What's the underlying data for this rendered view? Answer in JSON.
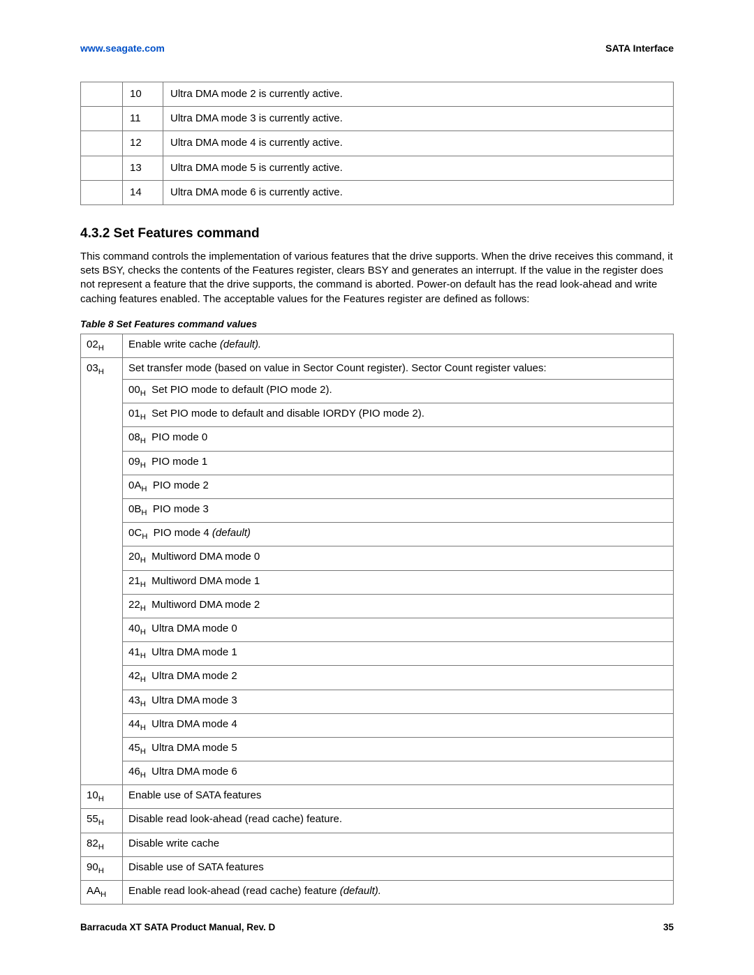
{
  "header": {
    "url": "www.seagate.com",
    "section": "SATA Interface"
  },
  "top_table": {
    "rows": [
      {
        "bit": "10",
        "desc": "Ultra DMA mode 2 is currently active."
      },
      {
        "bit": "11",
        "desc": "Ultra DMA mode 3 is currently active."
      },
      {
        "bit": "12",
        "desc": "Ultra DMA mode 4 is currently active."
      },
      {
        "bit": "13",
        "desc": "Ultra DMA mode 5 is currently active."
      },
      {
        "bit": "14",
        "desc": "Ultra DMA mode 6 is currently active."
      }
    ]
  },
  "section_head": "4.3.2  Set Features command",
  "section_text": "This command controls the implementation of various features that the drive supports. When the drive receives this command, it sets BSY, checks the contents of the Features register, clears BSY and generates an interrupt. If the value in the register does not represent a feature that the drive supports, the command is aborted. Power-on default has the read look-ahead and write caching features enabled. The acceptable values for the Features register are defined as follows:",
  "table_caption": "Table 8   Set Features command values",
  "features": {
    "row_02": {
      "code": "02",
      "desc_pre": "Enable write cache ",
      "desc_it": "(default)."
    },
    "row_03": {
      "code": "03",
      "desc": "Set transfer mode (based on value in Sector Count register). Sector Count register values:"
    },
    "sub_00": {
      "code": "00",
      "desc": "Set PIO mode to default (PIO mode 2)."
    },
    "sub_01": {
      "code": "01",
      "desc": "Set PIO mode to default and disable IORDY (PIO mode 2)."
    },
    "sub_08": {
      "code": "08",
      "desc": "PIO mode 0"
    },
    "sub_09": {
      "code": "09",
      "desc": "PIO mode 1"
    },
    "sub_0A": {
      "code": "0A",
      "desc": "PIO mode 2"
    },
    "sub_0B": {
      "code": "0B",
      "desc": "PIO mode 3"
    },
    "sub_0C": {
      "code": "0C",
      "desc_pre": "PIO mode 4 ",
      "desc_it": "(default)"
    },
    "sub_20": {
      "code": "20",
      "desc": "Multiword DMA mode 0"
    },
    "sub_21": {
      "code": "21",
      "desc": "Multiword DMA mode 1"
    },
    "sub_22": {
      "code": "22",
      "desc": "Multiword DMA mode 2"
    },
    "sub_40": {
      "code": "40",
      "desc": "Ultra DMA mode 0"
    },
    "sub_41": {
      "code": "41",
      "desc": "Ultra DMA mode 1"
    },
    "sub_42": {
      "code": "42",
      "desc": "Ultra DMA mode 2"
    },
    "sub_43": {
      "code": "43",
      "desc": "Ultra DMA mode 3"
    },
    "sub_44": {
      "code": "44",
      "desc": "Ultra DMA mode 4"
    },
    "sub_45": {
      "code": "45",
      "desc": "Ultra DMA mode 5"
    },
    "sub_46": {
      "code": "46",
      "desc": "Ultra DMA mode 6"
    },
    "row_10": {
      "code": "10",
      "desc": "Enable use of SATA features"
    },
    "row_55": {
      "code": "55",
      "desc": "Disable read look-ahead (read cache) feature."
    },
    "row_82": {
      "code": "82",
      "desc": "Disable write cache"
    },
    "row_90": {
      "code": "90",
      "desc": "Disable use of SATA features"
    },
    "row_AA": {
      "code": "AA",
      "desc_pre": "Enable read look-ahead (read cache) feature ",
      "desc_it": "(default)."
    }
  },
  "footer": {
    "manual": "Barracuda XT SATA Product Manual, Rev. D",
    "page": "35"
  },
  "subH": "H"
}
